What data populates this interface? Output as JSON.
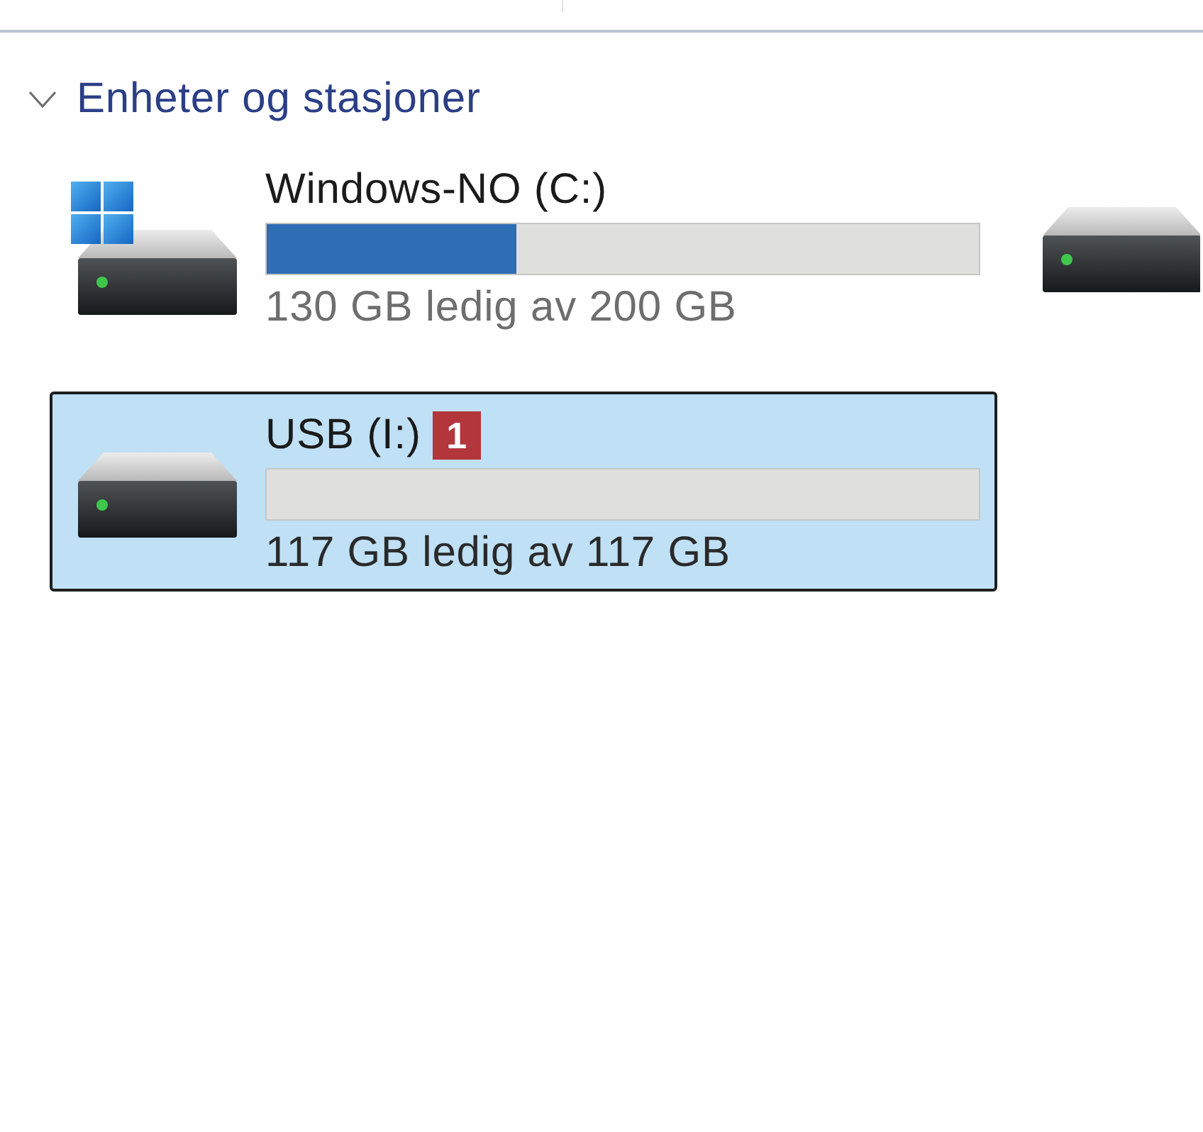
{
  "section": {
    "title": "Enheter og stasjoner",
    "expanded": true
  },
  "drives": [
    {
      "kind": "system",
      "name": "Windows-NO (C:)",
      "level": 0.35,
      "free_space": "130 GB ledig av 200 GB",
      "selected": false
    },
    {
      "kind": "disk",
      "selected": false
    },
    {
      "kind": "disk",
      "name": "USB (I:)",
      "badge": "1",
      "level": 0,
      "free_space": "117 GB ledig av 117 GB",
      "selected": true
    }
  ]
}
